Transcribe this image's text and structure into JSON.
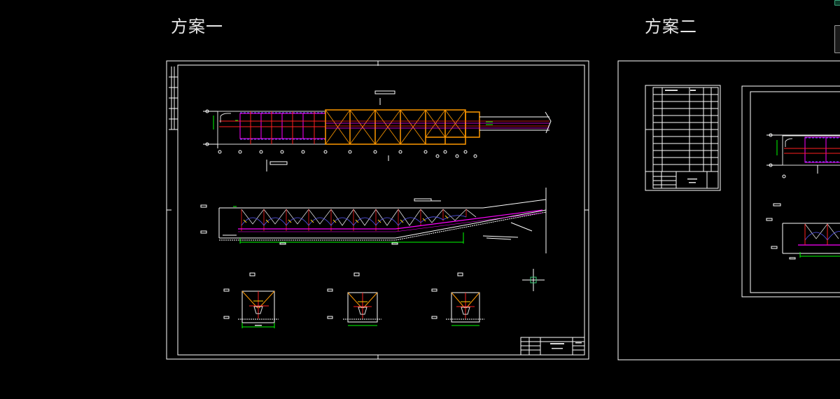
{
  "drawing": {
    "scheme_1_label": "方案一",
    "scheme_2_label": "方案二"
  },
  "ui": {
    "icons": [
      "navigation-cube-icon",
      "crosshair-cursor-icon"
    ],
    "colors": {
      "background": "#000000",
      "frame": "#ffffff",
      "orange": "#ff9900",
      "magenta": "#ff00ff",
      "red": "#ff2020",
      "green": "#00ff00",
      "blue": "#5a5aff"
    }
  }
}
